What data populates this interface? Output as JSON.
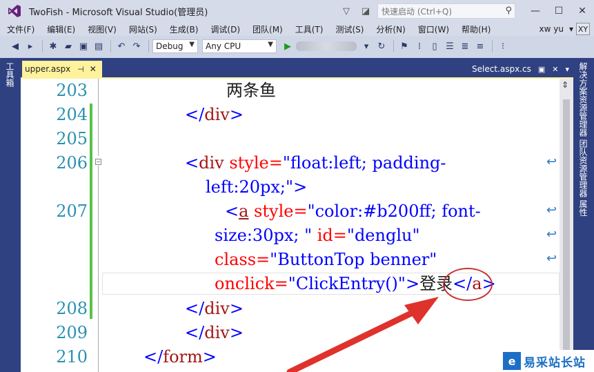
{
  "window": {
    "title": "TwoFish - Microsoft Visual Studio(管理员)",
    "quick_launch_placeholder": "快速启动 (Ctrl+Q)"
  },
  "menu": [
    "文件(F)",
    "编辑(E)",
    "视图(V)",
    "网站(S)",
    "生成(B)",
    "调试(D)",
    "团队(M)",
    "工具(T)",
    "测试(S)",
    "分析(N)",
    "窗口(W)",
    "帮助(H)"
  ],
  "user": {
    "name": "xw yu",
    "initials": "XY"
  },
  "toolbar": {
    "config": "Debug",
    "platform": "Any CPU"
  },
  "side_panels": {
    "left": "工具箱",
    "right": "解决方案资源管理器  团队资源管理器  属性"
  },
  "tabs": {
    "active": "upper.aspx",
    "other": "Select.aspx.cs"
  },
  "editor": {
    "line_numbers": [
      "203",
      "204",
      "205",
      "206",
      "207",
      "208",
      "209",
      "210"
    ],
    "lines": {
      "l203": "两条鱼",
      "l204": {
        "open": "</",
        "tag": "div",
        "close": ">"
      },
      "l206a": {
        "open": "<",
        "tag": "div",
        "attr": " style=",
        "val": "\"float:left; padding-"
      },
      "l206b": {
        "val": "left:20px;\"",
        "close": ">"
      },
      "l207a": {
        "open": "<",
        "tag": "a",
        "attr": " style=",
        "val": "\"color:#b200ff; font-"
      },
      "l207b": {
        "val": "size:30px; \"",
        "attr": " id=",
        "val2": "\"denglu\""
      },
      "l207c": {
        "attr": "class=",
        "val": "\"ButtonTop benner\""
      },
      "l207d": {
        "attr": "onclick=",
        "val": "\"ClickEntry()\"",
        "close": ">",
        "text": "登录",
        "endopen": "</",
        "endtag": "a",
        "endclose": ">"
      },
      "l208": {
        "open": "</",
        "tag": "div",
        "close": ">"
      },
      "l209": {
        "open": "</",
        "tag": "div",
        "close": ">"
      },
      "l210": {
        "open": "</",
        "tag": "form",
        "close": ">"
      }
    }
  },
  "watermark": {
    "logo": "e",
    "text": "易采站长站"
  }
}
